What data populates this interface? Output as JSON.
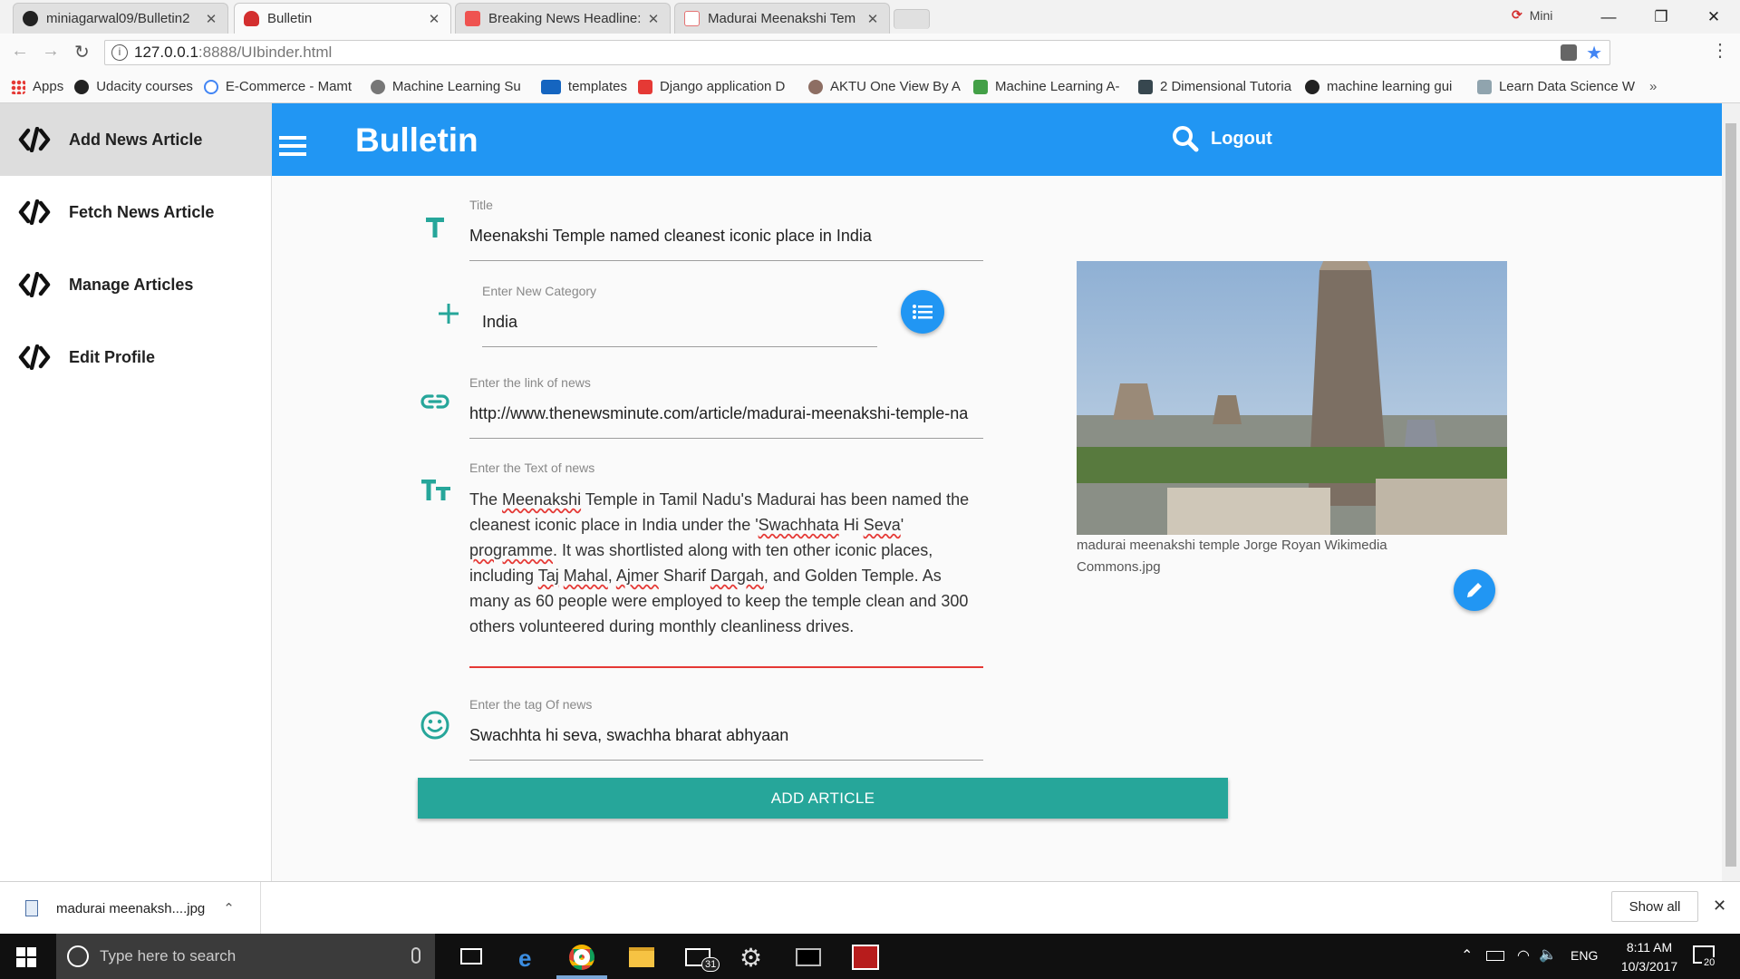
{
  "browser": {
    "tabs": [
      {
        "label": "miniagarwal09/Bulletin2",
        "icon": "github-icon"
      },
      {
        "label": "Bulletin",
        "icon": "bulletin-icon"
      },
      {
        "label": "Breaking News Headline:",
        "icon": "news-icon"
      },
      {
        "label": "Madurai Meenakshi Tem",
        "icon": "news-minute-icon"
      }
    ],
    "profile_name": "Mini",
    "url_host": "127.0.0.1",
    "url_rest": ":8888/UIbinder.html",
    "bookmarks": [
      {
        "label": "Apps",
        "icon": "apps-grid-icon",
        "color": "#4285f4"
      },
      {
        "label": "Udacity courses",
        "icon": "github-icon",
        "color": "#222222"
      },
      {
        "label": "E-Commerce - Mamt",
        "icon": "google-icon",
        "color": "#4285f4"
      },
      {
        "label": "Machine Learning Su",
        "icon": "atom-icon",
        "color": "#555555"
      },
      {
        "label": "templates",
        "icon": "tm-icon",
        "color": "#1565c0"
      },
      {
        "label": "Django application D",
        "icon": "youtube-icon",
        "color": "#e53935"
      },
      {
        "label": "AKTU One View By A",
        "icon": "aktu-icon",
        "color": "#8d6e63"
      },
      {
        "label": "Machine Learning A-",
        "icon": "u-icon",
        "color": "#43a047"
      },
      {
        "label": "2 Dimensional Tutoria",
        "icon": "h-icon",
        "color": "#37474f"
      },
      {
        "label": "machine learning gui",
        "icon": "github-icon",
        "color": "#222222"
      },
      {
        "label": "Learn Data Science W",
        "icon": "image-icon",
        "color": "#90a4ae"
      }
    ]
  },
  "sidebar": {
    "items": [
      {
        "label": "Add News Article",
        "active": true
      },
      {
        "label": "Fetch News Article",
        "active": false
      },
      {
        "label": "Manage Articles",
        "active": false
      },
      {
        "label": "Edit Profile",
        "active": false
      }
    ]
  },
  "header": {
    "brand": "Bulletin",
    "logout": "Logout",
    "color": "#2196f3"
  },
  "form": {
    "title_label": "Title",
    "title_value": "Meenakshi Temple named cleanest iconic place in India",
    "category_label": "Enter New Category",
    "category_value": "India",
    "link_label": "Enter the link of news",
    "link_value": "http://www.thenewsminute.com/article/madurai-meenakshi-temple-na",
    "text_label": "Enter the Text of news",
    "text_value": "The Meenakshi Temple in Tamil Nadu's Madurai has been named the cleanest iconic place in India under the 'Swachhata Hi Seva' programme. It was shortlisted along with ten other iconic places, including Taj Mahal, Ajmer Sharif Dargah, and Golden Temple. As many as 60 people were employed to keep the temple clean and 300 others volunteered during monthly cleanliness drives.",
    "tag_label": "Enter the tag Of news",
    "tag_value": "Swachhta hi seva, swachha bharat abhyaan",
    "submit_label": "ADD ARTICLE",
    "accent": "#26a69a",
    "error_color": "#e53935"
  },
  "image": {
    "caption": "madurai meenakshi temple Jorge Royan Wikimedia Commons.jpg"
  },
  "download": {
    "filename": "madurai meenaksh....jpg",
    "show_all": "Show all"
  },
  "taskbar": {
    "search_placeholder": "Type here to search",
    "mail_badge": "31",
    "language": "ENG",
    "time": "8:11 AM",
    "date": "10/3/2017",
    "notifications": "20"
  }
}
